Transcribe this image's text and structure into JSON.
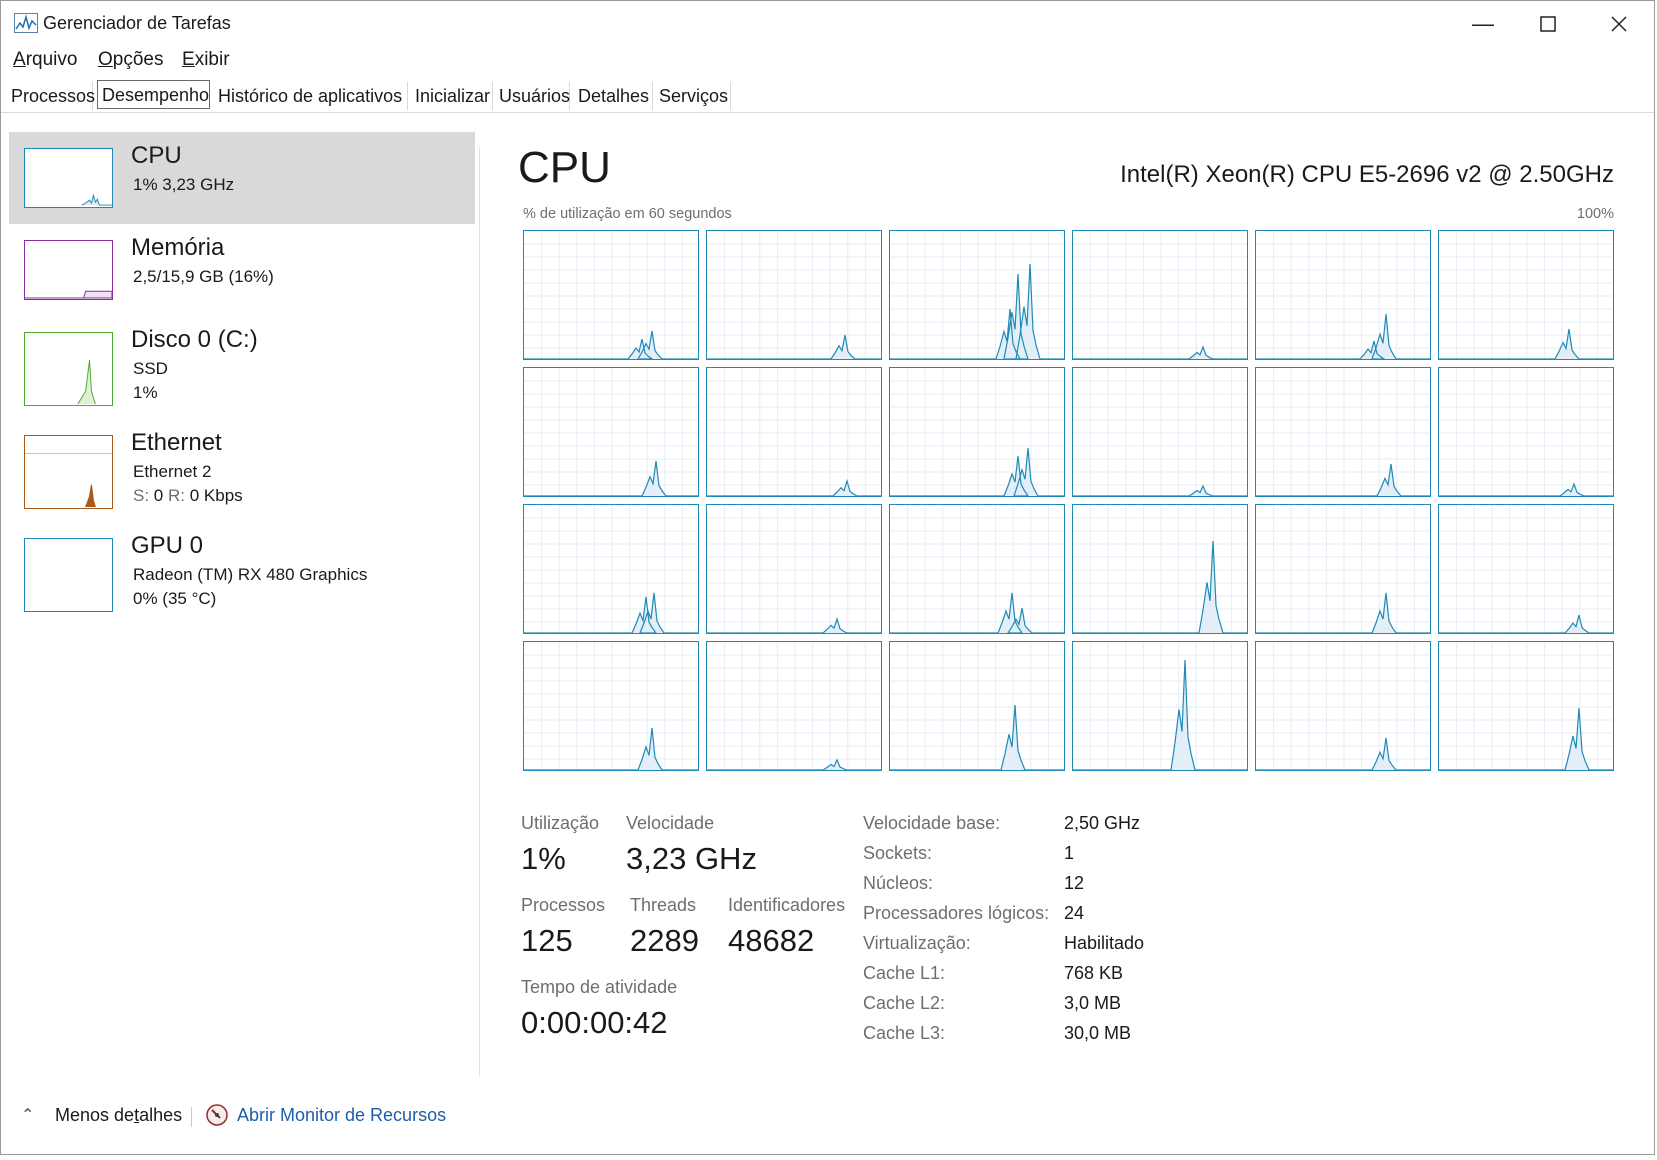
{
  "window": {
    "title": "Gerenciador de Tarefas",
    "icon": "task-manager-icon",
    "controls": [
      "minimize-icon",
      "maximize-icon",
      "close-icon"
    ]
  },
  "menu": {
    "arquivo": {
      "pre": "",
      "u": "A",
      "post": "rquivo"
    },
    "opcoes": {
      "pre": "",
      "u": "O",
      "post": "pções"
    },
    "exibir": {
      "pre": "",
      "u": "E",
      "post": "xibir"
    }
  },
  "tabs": [
    "Processos",
    "Desempenho",
    "Histórico de aplicativos",
    "Inicializar",
    "Usuários",
    "Detalhes",
    "Serviços"
  ],
  "active_tab": "Desempenho",
  "sidebar": {
    "cpu": {
      "title": "CPU",
      "sub": "1%  3,23 GHz",
      "color": "#1f8ab8"
    },
    "memory": {
      "title": "Memória",
      "sub": "2,5/15,9 GB (16%)",
      "color": "#8b2ea3"
    },
    "disk": {
      "title": "Disco 0 (C:)",
      "sub1": "SSD",
      "sub2": "1%",
      "color": "#4ea72e"
    },
    "ethernet": {
      "title": "Ethernet",
      "sub1": "Ethernet 2",
      "s_label": "S:",
      "s_value": "0",
      "r_label": "R:",
      "r_value": "0 Kbps",
      "color": "#a85a1b"
    },
    "gpu": {
      "title": "GPU 0",
      "sub1": "Radeon (TM) RX 480 Graphics",
      "sub2": "0%  (35 °C)",
      "color": "#1f8ab8"
    }
  },
  "main": {
    "title": "CPU",
    "model": "Intel(R) Xeon(R) CPU E5-2696 v2 @ 2.50GHz",
    "graph_label": "% de utilização em 60 segundos",
    "graph_max": "100%",
    "stats": {
      "utilizacao_label": "Utilização",
      "utilizacao": "1%",
      "velocidade_label": "Velocidade",
      "velocidade": "3,23 GHz",
      "processos_label": "Processos",
      "processos": "125",
      "threads_label": "Threads",
      "threads": "2289",
      "identificadores_label": "Identificadores",
      "identificadores": "48682",
      "tempo_label": "Tempo de atividade",
      "tempo": "0:00:00:42"
    },
    "details": [
      {
        "label": "Velocidade base:",
        "value": "2,50 GHz"
      },
      {
        "label": "Sockets:",
        "value": "1"
      },
      {
        "label": "Núcleos:",
        "value": "12"
      },
      {
        "label": "Processadores lógicos:",
        "value": "24"
      },
      {
        "label": "Virtualização:",
        "value": "Habilitado"
      },
      {
        "label": "Cache L1:",
        "value": "768 KB"
      },
      {
        "label": "Cache L2:",
        "value": "3,0 MB"
      },
      {
        "label": "Cache L3:",
        "value": "30,0 MB"
      }
    ]
  },
  "footer": {
    "less_details": {
      "pre": "Menos de",
      "u": "t",
      "post": "alhes"
    },
    "resource_monitor": "Abrir Monitor de Recursos"
  }
}
